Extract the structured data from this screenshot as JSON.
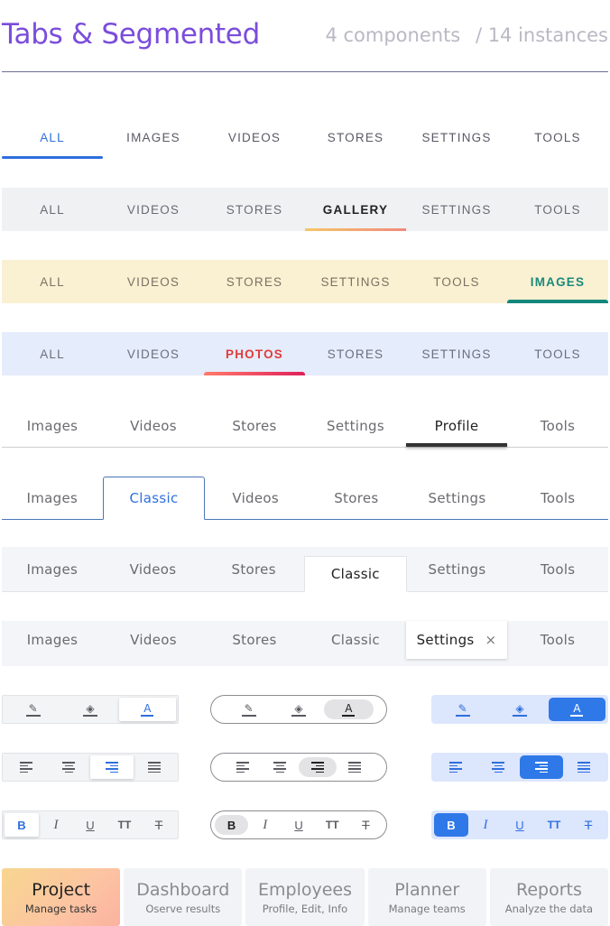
{
  "header": {
    "title": "Tabs & Segmented",
    "components": "4 components",
    "instances": "/ 14 instances"
  },
  "row1": [
    "ALL",
    "IMAGES",
    "VIDEOS",
    "STORES",
    "SETTINGS",
    "TOOLS"
  ],
  "row2": [
    "ALL",
    "VIDEOS",
    "STORES",
    "GALLERY",
    "SETTINGS",
    "TOOLS"
  ],
  "row3": [
    "ALL",
    "VIDEOS",
    "STORES",
    "SETTINGS",
    "TOOLS",
    "IMAGES"
  ],
  "row4": [
    "ALL",
    "VIDEOS",
    "PHOTOS",
    "STORES",
    "SETTINGS",
    "TOOLS"
  ],
  "row5": [
    "Images",
    "Videos",
    "Stores",
    "Settings",
    "Profile",
    "Tools"
  ],
  "row6": [
    "Images",
    "Classic",
    "Videos",
    "Stores",
    "Settings",
    "Tools"
  ],
  "row7": [
    "Images",
    "Videos",
    "Stores",
    "Classic",
    "Settings",
    "Tools"
  ],
  "row8": [
    "Images",
    "Videos",
    "Stores",
    "Classic",
    "Settings",
    "Tools"
  ],
  "row8_close": "×",
  "text_format_icons": {
    "bold": "B",
    "italic": "I",
    "underline": "U",
    "text_size": "TT",
    "strikethrough": "T",
    "color": "A"
  },
  "navstrip": [
    {
      "title": "Project",
      "subtitle": "Manage tasks"
    },
    {
      "title": "Dashboard",
      "subtitle": "Oserve results"
    },
    {
      "title": "Employees",
      "subtitle": "Profile, Edit, Info"
    },
    {
      "title": "Planner",
      "subtitle": "Manage teams"
    },
    {
      "title": "Reports",
      "subtitle": "Analyze the data"
    }
  ],
  "colors": {
    "title": "#7b4ddb",
    "blue_accent": "#2f6fde",
    "teal_accent": "#13877b",
    "red_accent": "#e03b3b"
  }
}
